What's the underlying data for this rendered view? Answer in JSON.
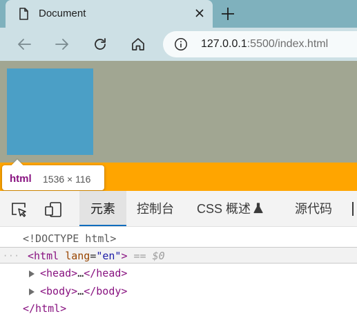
{
  "browser": {
    "tab_title": "Document",
    "address": {
      "host": "127.0.0.1",
      "rest": ":5500/index.html"
    }
  },
  "page": {
    "colors": {
      "margin_overlay": "#a1a692",
      "box": "#4b9fc6",
      "html_overlay": "#ffa500"
    }
  },
  "tooltip": {
    "tag": "html",
    "size": "1536 × 116"
  },
  "devtools": {
    "tabs": [
      {
        "label": "元素",
        "active": true
      },
      {
        "label": "控制台",
        "active": false
      },
      {
        "label": "CSS 概述",
        "active": false
      },
      {
        "label": "源代码",
        "active": false
      }
    ],
    "dom": {
      "doctype": "<!DOCTYPE html>",
      "html_open_tag": "<html",
      "html_attr_name": "lang",
      "html_attr_eq": "=",
      "html_attr_value": "\"en\"",
      "html_open_end": ">",
      "selected_marker": "== $0",
      "head": {
        "open": "<head>",
        "ellipsis": "…",
        "close": "</head>"
      },
      "body": {
        "open": "<body>",
        "ellipsis": "…",
        "close": "</body>"
      },
      "html_close": "</html>"
    }
  }
}
